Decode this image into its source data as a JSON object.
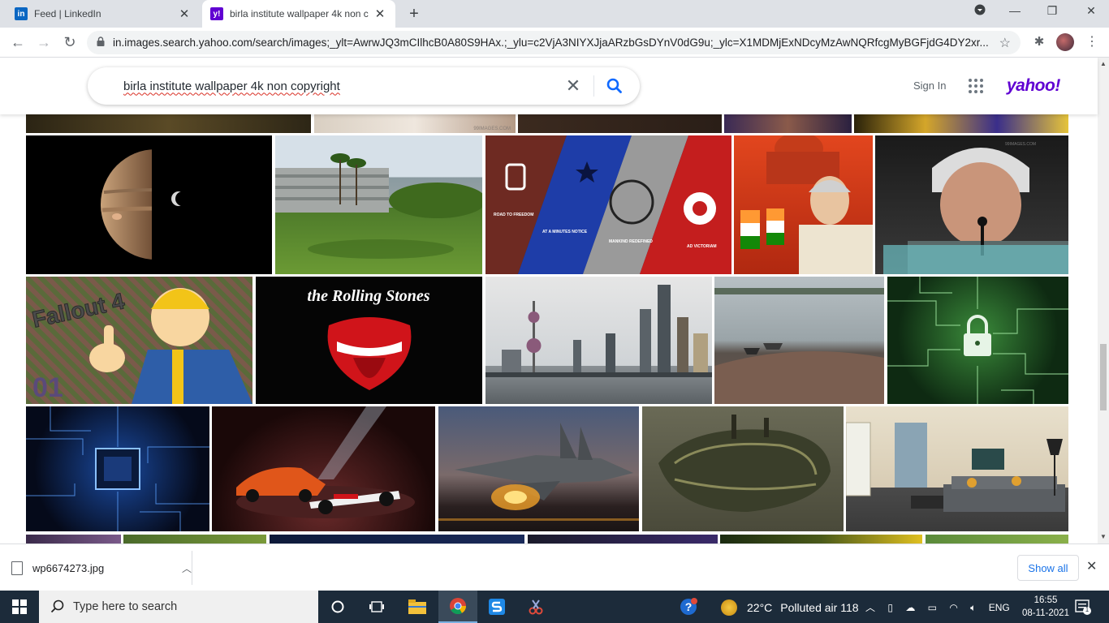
{
  "browser": {
    "tabs": [
      {
        "title": "Feed | LinkedIn",
        "active": false
      },
      {
        "title": "birla institute wallpaper 4k non c",
        "active": true
      }
    ],
    "url": "in.images.search.yahoo.com/search/images;_ylt=AwrwJQ3mCIlhcB0A80S9HAx.;_ylu=c2VjA3NIYXJjaARzbGsDYnV0dG9u;_ylc=X1MDMjExNDcyMzAwNQRfcgMyBGFjdG4DY2xr..."
  },
  "yahoo": {
    "query": "birla institute wallpaper 4k non copyright",
    "signin_label": "Sign In",
    "logo_text": "yahoo!"
  },
  "thumbs": {
    "img3": [
      "ROAD TO FREEDOM",
      "AT A MINUTES NOTICE",
      "MANKIND REDEFINED",
      "AD VICTORIAM"
    ],
    "img7": [
      "Fallout 4",
      "01"
    ],
    "img8": "the Rolling Stones",
    "watermark": "99IMAGES.COM"
  },
  "downloads": {
    "file_name": "wp6674273.jpg",
    "show_all_label": "Show all"
  },
  "taskbar": {
    "search_placeholder": "Type here to search",
    "weather_temp": "22°C",
    "weather_text": "Polluted air 118",
    "language": "ENG",
    "time": "16:55",
    "date": "08-11-2021",
    "notification_count": "1"
  },
  "colors": {
    "yahoo_purple": "#6001d2",
    "taskbar_bg": "#1c2b3a",
    "link_blue": "#1a73e8"
  }
}
